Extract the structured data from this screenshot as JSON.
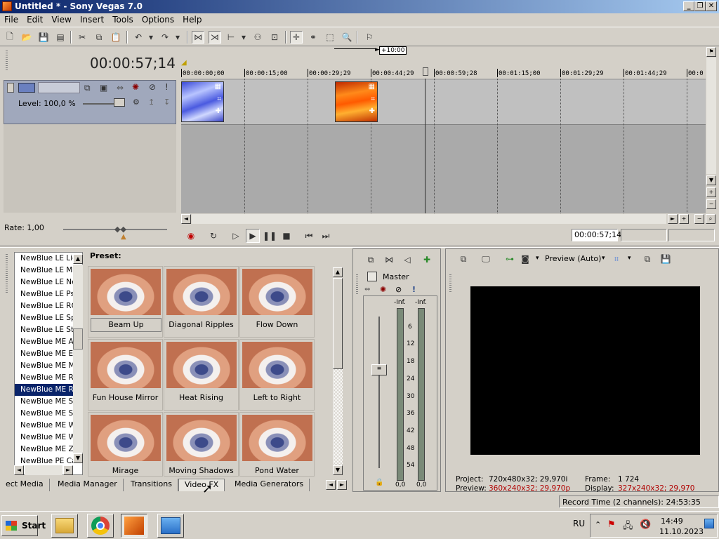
{
  "window": {
    "title": "Untitled * - Sony Vegas 7.0",
    "minimize_glyph": "_",
    "restore_glyph": "❐",
    "close_glyph": "✕"
  },
  "menu": [
    "File",
    "Edit",
    "View",
    "Insert",
    "Tools",
    "Options",
    "Help"
  ],
  "timecode": "00:00:57;14",
  "ruler": {
    "marker": "+10:00",
    "ticks": [
      "00:00:00;00",
      "00:00:15;00",
      "00:00:29;29",
      "00:00:44;29",
      "00:00:59;28",
      "00:01:15;00",
      "00:01:29;29",
      "00:01:44;29",
      "00:0"
    ]
  },
  "track": {
    "level": "Level: 100,0 %"
  },
  "rate": "Rate: 1,00",
  "transport": {
    "position": "00:00:57;14"
  },
  "fx_list": {
    "items": [
      "NewBlue LE Light",
      "NewBlue LE Mir",
      "NewBlue LE Nei",
      "NewBlue LE Psy",
      "NewBlue LE RG",
      "NewBlue LE Spi",
      "NewBlue LE Sta",
      "NewBlue ME Ac",
      "NewBlue ME Ea",
      "NewBlue ME Mo",
      "NewBlue ME Rip",
      "NewBlue ME Ro",
      "NewBlue ME Sh",
      "NewBlue ME Sp",
      "NewBlue ME Wa",
      "NewBlue ME Wi",
      "NewBlue ME Zo",
      "NewBlue PE Ca"
    ],
    "selected_index": 11
  },
  "presets": {
    "label": "Preset:",
    "items": [
      "Beam Up",
      "Diagonal Ripples",
      "Flow Down",
      "Fun House Mirror",
      "Heat Rising",
      "Left to Right",
      "Mirage",
      "Moving Shadows",
      "Pond Water"
    ]
  },
  "tabs": [
    "ect Media",
    "Media Manager",
    "Transitions",
    "Video FX",
    "Media Generators"
  ],
  "active_tab": "Video FX",
  "mixer": {
    "master": "Master",
    "inf_left": "-Inf.",
    "inf_right": "-Inf.",
    "scale": [
      "6",
      "12",
      "18",
      "24",
      "30",
      "36",
      "42",
      "48",
      "54"
    ],
    "value_left": "0,0",
    "value_right": "0,0"
  },
  "preview": {
    "mode": "Preview (Auto)",
    "project_label": "Project:",
    "project_value": "720x480x32; 29,970i",
    "preview_label": "Preview:",
    "preview_value": "360x240x32; 29,970p",
    "frame_label": "Frame:",
    "frame_value": "1 724",
    "display_label": "Display:",
    "display_value": "327x240x32; 29,970"
  },
  "status": {
    "record_time": "Record Time (2 channels): 24:53:35"
  },
  "taskbar": {
    "start": "Start",
    "lang": "RU",
    "time": "14:49",
    "date": "11.10.2023"
  },
  "colors": {
    "title_gradient_start": "#0a246a",
    "title_gradient_end": "#a6caf0",
    "selection": "#0a246a",
    "warning_text": "#b00000"
  }
}
